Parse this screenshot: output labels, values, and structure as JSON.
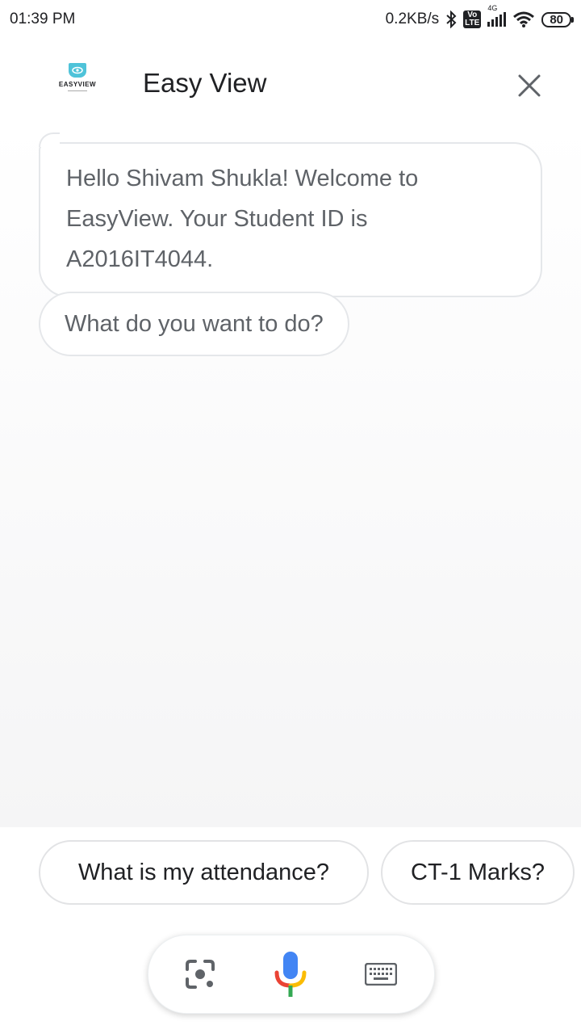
{
  "status_bar": {
    "time": "01:39 PM",
    "network_speed": "0.2KB/s",
    "volte": "Vo LTE",
    "network_type": "4G",
    "battery": "80"
  },
  "header": {
    "logo_text": "EASYVIEW",
    "title": "Easy View"
  },
  "chat": {
    "welcome_message": "Hello Shivam Shukla! Welcome to EasyView. Your Student ID is A2016IT4044.",
    "prompt_message": "What do you want to do?"
  },
  "suggestions": [
    {
      "label": "What is my attendance?"
    },
    {
      "label": "CT-1 Marks?"
    }
  ],
  "colors": {
    "logo_accent": "#4fc3d9",
    "mic_blue": "#4285f4",
    "mic_red": "#ea4335",
    "mic_yellow": "#fbbc05",
    "mic_green": "#34a853"
  },
  "icons": [
    "bluetooth-icon",
    "signal-icon",
    "wifi-icon",
    "battery-icon",
    "close-icon",
    "lens-icon",
    "mic-icon",
    "keyboard-icon"
  ]
}
